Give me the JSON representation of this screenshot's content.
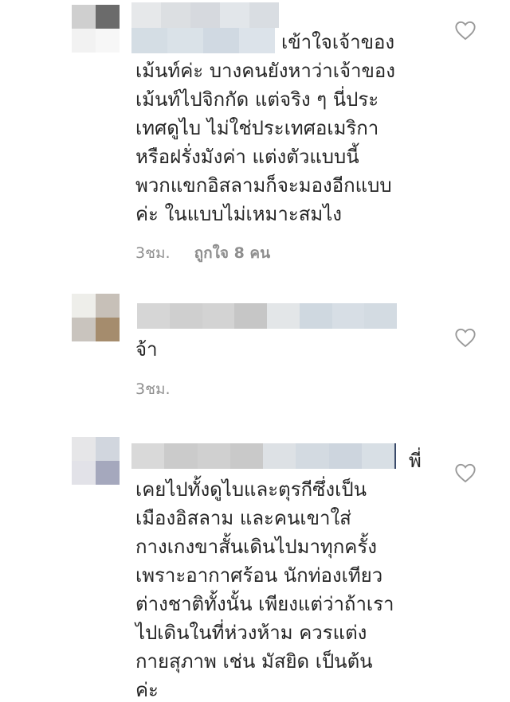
{
  "comments": [
    {
      "text": "เข้าใจเจ้าของ\nเม้นท์ค่ะ บางคนยังหาว่าเจ้าของ\nเม้นท์ไปจิกกัด แต่จริง ๆ นี่ประ\nเทศดูไบ ไม่ใช่ประเทศอเมริกา\nหรือฝรั่งมังค่า แต่งตัวแบบนี้\nพวกแขกอิสลามก็จะมองอีกแบบ\nค่ะ ในแบบไม่เหมาะสมไง",
      "time": "3ชม.",
      "likes": "ถูกใจ 8 คน"
    },
    {
      "text": "จ้า",
      "time": "3ชม."
    },
    {
      "text": "พี่\nเคยไปทั้งดูไบและตุรกีซึ่งเป็น\nเมืองอิสลาม และคนเขาใส่\nกางเกงขาสั้นเดินไปมาทุกครั้ง\nเพราะอากาศร้อน นักท่องเทียว\nต่างชาติทั้งนั้น เพียงแต่ว่าถ้าเรา\nไปเดินในที่ห่วงห้าม ควรแต่ง\nกายสุภาพ เช่น มัสยิด เป็นต้น\nค่ะ"
    }
  ],
  "icons": {
    "like": "heart-outline-icon"
  },
  "colors": {
    "text": "#262626",
    "meta": "#8e8e8e",
    "heart": "#999999"
  }
}
